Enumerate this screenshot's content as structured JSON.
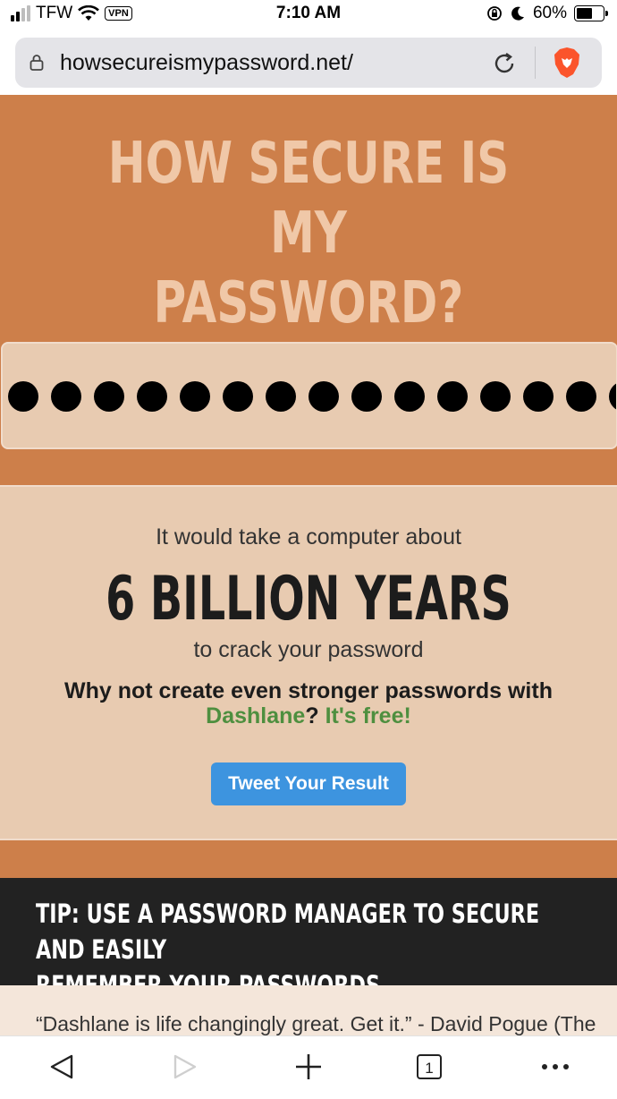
{
  "status_bar": {
    "carrier": "TFW",
    "vpn": "VPN",
    "time": "7:10 AM",
    "battery": "60%"
  },
  "browser": {
    "url": "howsecureismypassword.net/"
  },
  "hero": {
    "title_line1": "HOW SECURE IS MY",
    "title_line2": "PASSWORD?"
  },
  "result": {
    "line1": "It would take a computer about",
    "duration": "6 BILLION YEARS",
    "line3": "to crack your password",
    "why_prefix": "Why not create even stronger passwords with",
    "brand": "Dashlane",
    "qmark": "?",
    "free": "It's free!",
    "tweet_button": "Tweet Your Result"
  },
  "tip": {
    "line1": "TIP: USE A PASSWORD MANAGER TO SECURE AND EASILY",
    "line2": "REMEMBER YOUR PASSWORDS"
  },
  "quote": {
    "text": "“Dashlane is life changingly great. Get it.” - David Pogue (The"
  },
  "toolbar": {
    "tab_count": "1"
  },
  "colors": {
    "hero_bg": "#cd7f4a",
    "panel_bg": "#e8cbb1",
    "accent_green": "#4e8f3f",
    "tweet_blue": "#3d94df",
    "tip_bg": "#222222"
  }
}
